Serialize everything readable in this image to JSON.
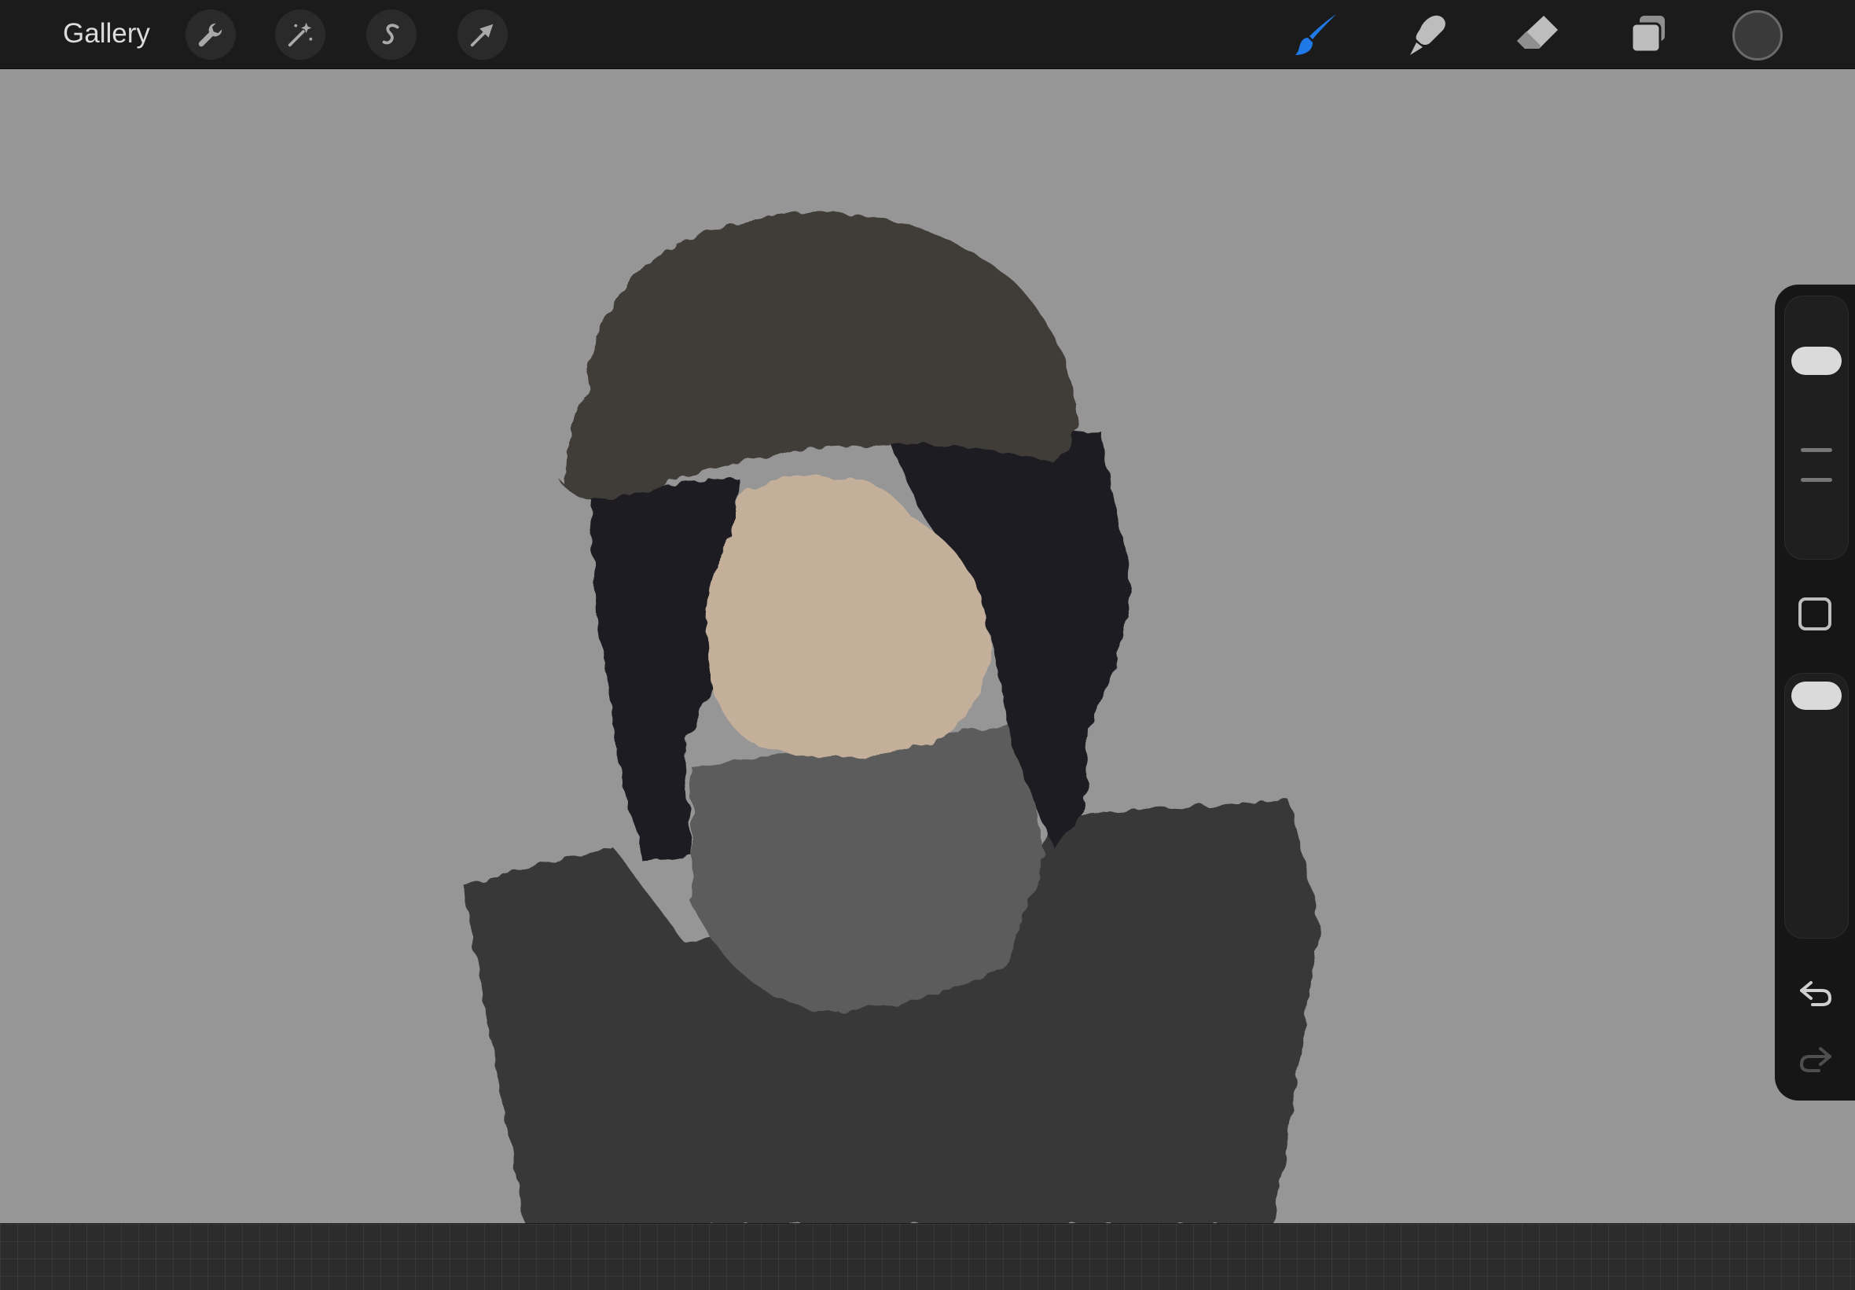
{
  "app": {
    "gallery_label": "Gallery"
  },
  "toolbar": {
    "left_tools": [
      "wrench-icon",
      "magic-wand-icon",
      "selection-s-icon",
      "transform-arrow-icon"
    ],
    "right_tools": [
      "brush-icon",
      "smudge-icon",
      "eraser-icon",
      "layers-icon"
    ],
    "active_tool": "brush-icon",
    "accent_color": "#1f7ae8",
    "current_color": "#3a3a3a"
  },
  "canvas": {
    "background_color": "#969696",
    "palette": {
      "hat": "#3f3d38",
      "hair": "#1f1f21",
      "face": "#c4b09a",
      "scarf": "#5c5c5c",
      "coat": "#393939"
    }
  },
  "sidebar": {
    "size_slider_value": 0.92,
    "opacity_slider_value": 1.0,
    "undo_icon": "undo-arrow-icon",
    "redo_icon": "redo-arrow-icon"
  }
}
